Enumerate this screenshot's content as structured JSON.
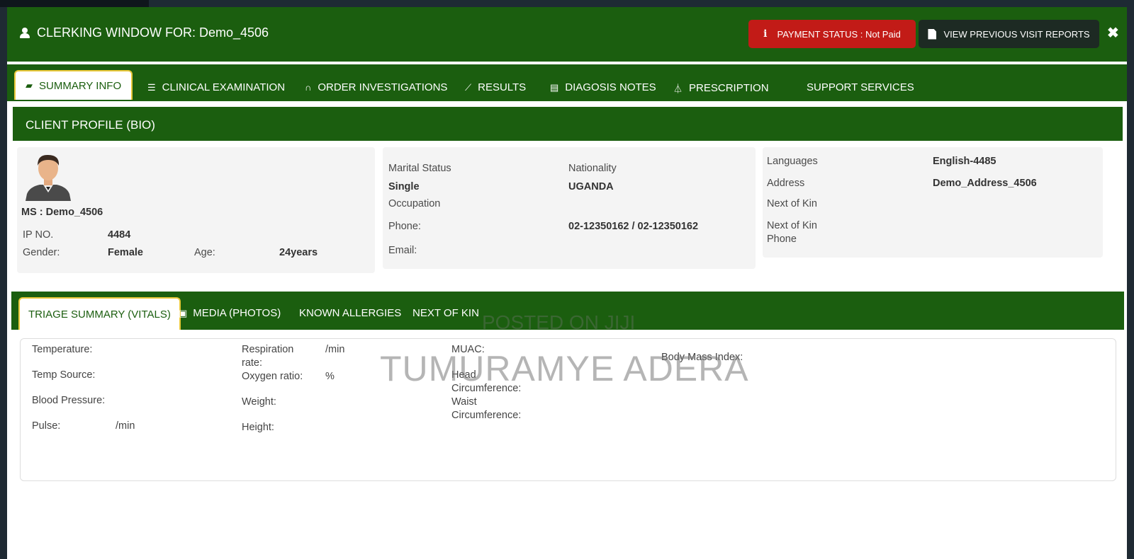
{
  "header": {
    "title": "CLERKING WINDOW FOR: Demo_4506",
    "payment_status": "PAYMENT STATUS : Not Paid",
    "prev_reports": "VIEW PREVIOUS VISIT REPORTS",
    "close": "✖"
  },
  "tabs": [
    {
      "label": "SUMMARY INFO",
      "icon": "book-icon"
    },
    {
      "label": "CLINICAL EXAMINATION",
      "icon": "list-icon"
    },
    {
      "label": "ORDER INVESTIGATIONS",
      "icon": "binoculars-icon"
    },
    {
      "label": "RESULTS",
      "icon": "chart-icon"
    },
    {
      "label": "DIAGOSIS NOTES",
      "icon": "keyboard-icon"
    },
    {
      "label": "PRESCRIPTION",
      "icon": "flask-icon"
    },
    {
      "label": "SUPPORT SERVICES",
      "icon": ""
    }
  ],
  "profile": {
    "section_title": "CLIENT PROFILE (BIO)",
    "name": "MS : Demo_4506",
    "ip_label": "IP NO.",
    "ip_value": "4484",
    "gender_label": "Gender:",
    "gender_value": "Female",
    "age_label": "Age:",
    "age_value": "24years",
    "marital_label": "Marital Status",
    "marital_value": "Single",
    "nationality_label": "Nationality",
    "nationality_value": "UGANDA",
    "occupation_label": "Occupation",
    "phone_label": "Phone:",
    "phone_value": "02-12350162 / 02-12350162",
    "email_label": "Email:",
    "languages_label": "Languages",
    "languages_value": "English-4485",
    "address_label": "Address",
    "address_value": "Demo_Address_4506",
    "nok_label": "Next of Kin",
    "nok_phone_label_1": "Next of Kin",
    "nok_phone_label_2": "Phone"
  },
  "vital_tabs": [
    {
      "label": "TRIAGE SUMMARY (VITALS)"
    },
    {
      "label": "MEDIA (PHOTOS)",
      "icon": "image-icon"
    },
    {
      "label": "KNOWN ALLERGIES"
    },
    {
      "label": "NEXT OF KIN"
    }
  ],
  "vitals": {
    "temperature": "Temperature:",
    "temp_source": "Temp Source:",
    "blood_pressure": "Blood Pressure:",
    "pulse": "Pulse:",
    "pulse_unit": "/min",
    "respiration_1": "Respiration",
    "respiration_2": "rate:",
    "respiration_unit": "/min",
    "oxygen": "Oxygen ratio:",
    "oxygen_unit": "%",
    "weight": "Weight:",
    "height": "Height:",
    "muac": "MUAC:",
    "head_1": "Head",
    "head_2": "Circumference:",
    "waist_1": "Waist",
    "waist_2": "Circumference:",
    "bmi": "Body Mass Index:"
  },
  "watermark": {
    "line1": "POSTED ON JIJI",
    "line2": "TUMURAMYE ADERA"
  },
  "colors": {
    "brand_green": "#1b5e0f",
    "payment_red": "#c21b17",
    "dark_button": "#1d2a23",
    "active_tab_border": "#e9c83a"
  }
}
